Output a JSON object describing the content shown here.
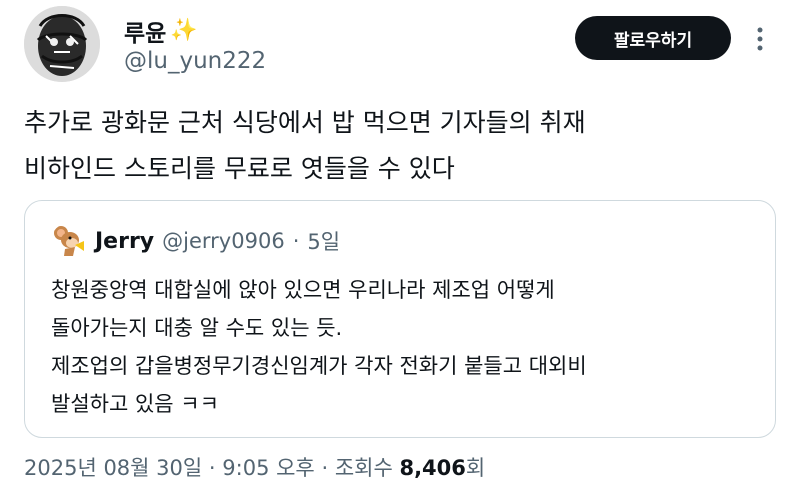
{
  "author": {
    "display_name": "루윤",
    "badge_emoji": "✨",
    "handle": "@lu_yun222",
    "avatar_icon": "sketch-portrait-avatar"
  },
  "actions": {
    "follow_label": "팔로우하기",
    "more_icon": "vertical-ellipsis-icon"
  },
  "tweet": {
    "lines": [
      "추가로 광화문 근처 식당에서 밥 먹으면 기자들의 취재",
      "비하인드 스토리를 무료로 엿들을 수 있다"
    ]
  },
  "quoted_tweet": {
    "display_name": "Jerry",
    "handle": "@jerry0906",
    "separator": "·",
    "time": "5일",
    "avatar_icon": "jerry-mouse-avatar",
    "lines": [
      "창원중앙역 대합실에 앉아 있으면 우리나라 제조업 어떻게",
      "돌아가는지 대충 알 수도 있는 듯.",
      "제조업의 갑을병정무기경신임계가 각자 전화기 붙들고 대외비",
      "발설하고 있음 ㅋㅋ"
    ]
  },
  "footer": {
    "date": "2025년 08월 30일",
    "separator": "·",
    "time": "9:05 오후",
    "views_label": "조회수",
    "views_count": "8,406",
    "views_suffix": "회"
  },
  "colors": {
    "text": "#0f1419",
    "secondary": "#536471",
    "border": "#cfd9de",
    "button_bg": "#0f1419",
    "button_text": "#ffffff",
    "sparkle": "#f5c518"
  }
}
